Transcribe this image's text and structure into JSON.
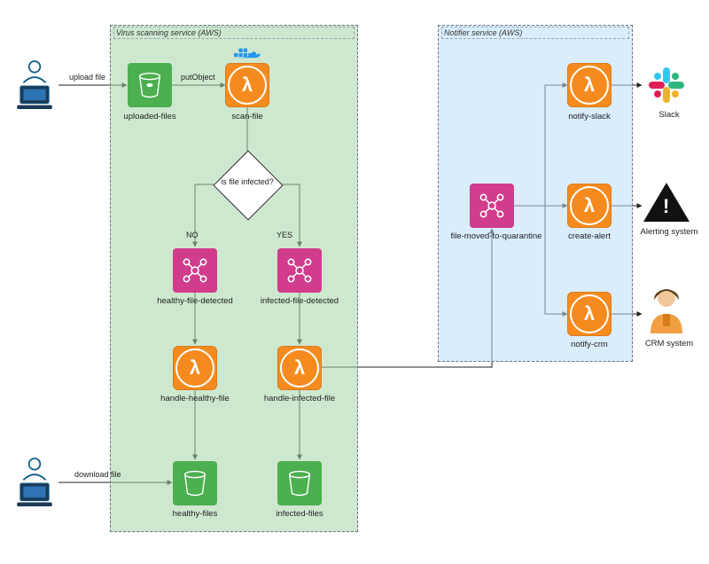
{
  "groups": {
    "scanner": {
      "title": "Virus scanning service (AWS)"
    },
    "notifier": {
      "title": "Notifier service (AWS)"
    }
  },
  "actors": {
    "uploader": "",
    "downloader": ""
  },
  "nodes": {
    "uploaded_bucket": "uploaded-files",
    "scan_lambda": "scan-file",
    "decision": "is file infected?",
    "decision_no": "NO",
    "decision_yes": "YES",
    "healthy_event": "healthy-file-detected",
    "infected_event": "infected-file-detected",
    "handle_healthy": "handle-healthy-file",
    "handle_infected": "handle-infected-file",
    "healthy_bucket": "healthy-files",
    "infected_bucket": "infected-files",
    "quarantine_event": "file-moved-to-quarantine",
    "notify_slack": "notify-slack",
    "create_alert": "create-alert",
    "notify_crm": "notify-crm"
  },
  "external": {
    "slack": "Slack",
    "alerting": "Alerting system",
    "crm": "CRM system"
  },
  "edges": {
    "upload": "upload file",
    "putObject": "putObject",
    "download": "download file"
  },
  "icons": {
    "docker": "docker-icon"
  }
}
